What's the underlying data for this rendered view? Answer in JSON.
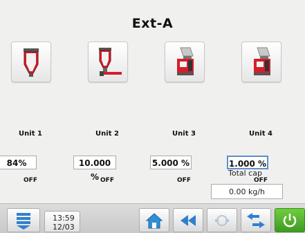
{
  "header": {
    "title": "Ext-A"
  },
  "units": [
    {
      "label": "Unit 1",
      "value": "84%",
      "state": "OFF",
      "icon": "hopper-icon"
    },
    {
      "label": "Unit 2",
      "value": "10.000 %",
      "state": "OFF",
      "icon": "hopper-doser-icon"
    },
    {
      "label": "Unit 3",
      "value": "5.000 %",
      "state": "OFF",
      "icon": "feeder-machine-icon"
    },
    {
      "label": "Unit 4",
      "value": "1.000 %",
      "state": "OFF",
      "icon": "feeder-machine-icon"
    }
  ],
  "total_cap": {
    "label": "Total cap",
    "value": "0.00 kg/h"
  },
  "status_bar": {
    "time": "13:59",
    "date": "12/03"
  },
  "colors": {
    "accent_red": "#c8202a",
    "accent_blue": "#2f7fd0",
    "power_green": "#4caf2d"
  }
}
